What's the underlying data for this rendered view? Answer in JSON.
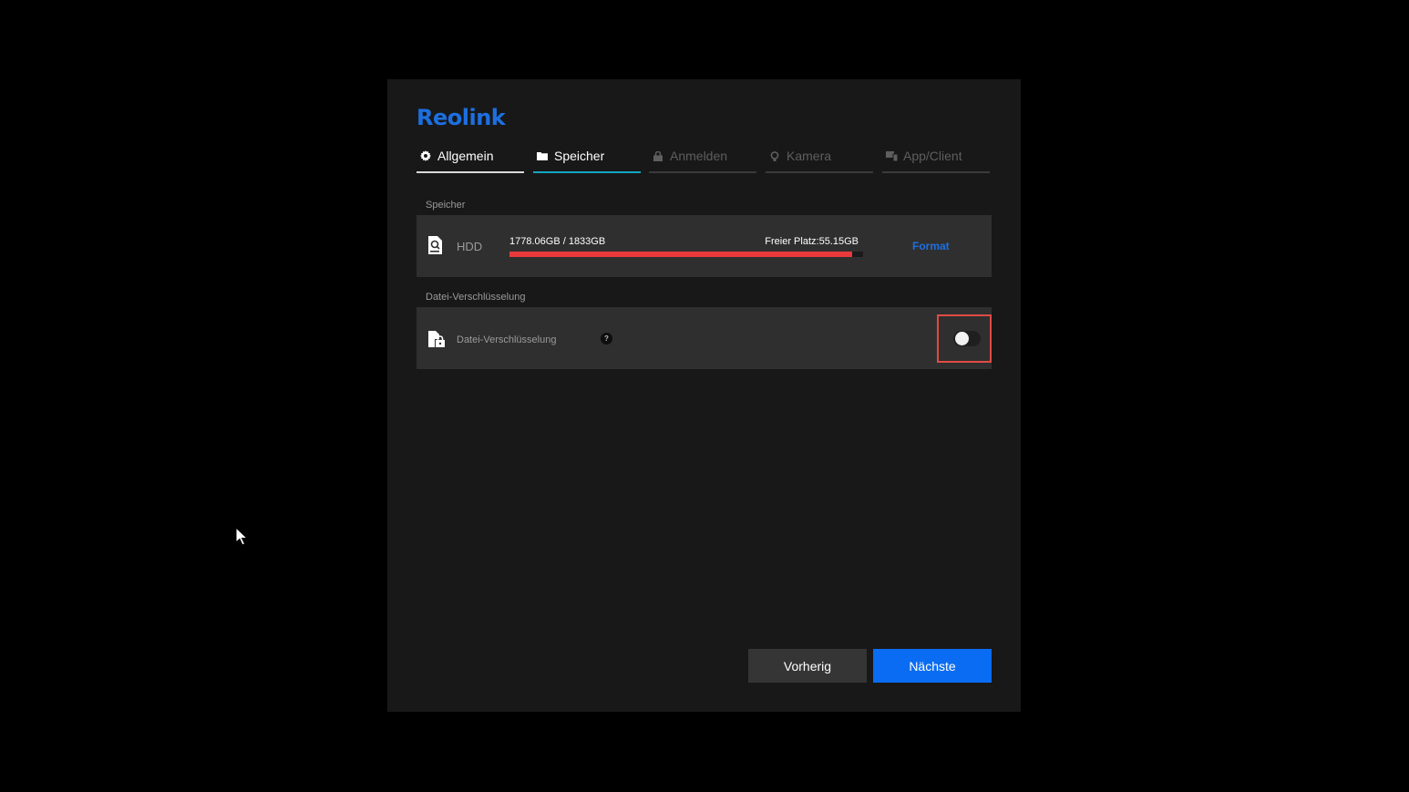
{
  "brand": {
    "name": "Reolink",
    "color": "#1d6fe0"
  },
  "tabs": [
    {
      "label": "Allgemein",
      "icon": "gear-icon",
      "state": "completed"
    },
    {
      "label": "Speicher",
      "icon": "folder-icon",
      "state": "active"
    },
    {
      "label": "Anmelden",
      "icon": "lock-icon",
      "state": "inactive"
    },
    {
      "label": "Kamera",
      "icon": "camera-icon",
      "state": "inactive"
    },
    {
      "label": "App/Client",
      "icon": "devices-icon",
      "state": "inactive"
    }
  ],
  "storage": {
    "section_label": "Speicher",
    "device_label": "HDD",
    "used_text": "1778.06GB / 1833GB",
    "free_text": "Freier Platz:55.15GB",
    "usage_fraction": 0.97,
    "bar_color": "#e8393c",
    "format_label": "Format"
  },
  "encryption": {
    "section_label": "Datei-Verschlüsselung",
    "row_label": "Datei-Verschlüsselung",
    "help_glyph": "?",
    "enabled": false
  },
  "footer": {
    "prev_label": "Vorherig",
    "next_label": "Nächste",
    "next_color": "#0a6cf2"
  }
}
